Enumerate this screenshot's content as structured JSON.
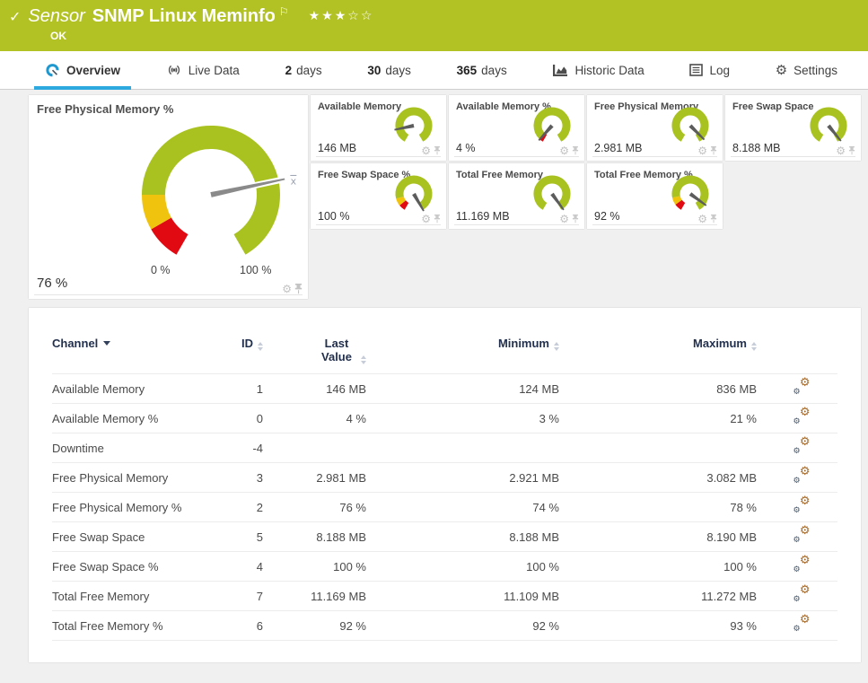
{
  "header": {
    "kind": "Sensor",
    "title": "SNMP Linux Meminfo",
    "status": "OK",
    "stars": "★★★☆☆",
    "stars_filled": 3,
    "stars_total": 5
  },
  "icons": {
    "check": "✓",
    "flag": "⚐",
    "gear": "⚙",
    "avg_marker": "x"
  },
  "colors": {
    "header_bg": "#b2c224",
    "green": "#a9c21f",
    "yellow": "#f0c30f",
    "red": "#e10a12",
    "accent_blue": "#2ea9e0",
    "needle_main": "#8a8a8a",
    "needle_small": "#5c5c5c"
  },
  "tabs": [
    {
      "icon": "gauge",
      "strong": "",
      "label": "Overview",
      "active": true
    },
    {
      "icon": "live",
      "strong": "",
      "label": "Live Data",
      "active": false
    },
    {
      "icon": "",
      "strong": "2",
      "label": "days",
      "active": false
    },
    {
      "icon": "",
      "strong": "30",
      "label": "days",
      "active": false
    },
    {
      "icon": "",
      "strong": "365",
      "label": "days",
      "active": false
    },
    {
      "icon": "historic",
      "strong": "",
      "label": "Historic Data",
      "active": false
    },
    {
      "icon": "log",
      "strong": "",
      "label": "Log",
      "active": false
    },
    {
      "icon": "settings",
      "strong": "",
      "label": "Settings",
      "active": false
    }
  ],
  "panels": {
    "main": {
      "title": "Free Physical Memory %",
      "value": "76 %",
      "min": "0 %",
      "max": "100 %",
      "needle_pct": 76,
      "avg_pct": 77,
      "segments": [
        [
          0,
          10,
          "red"
        ],
        [
          10,
          20,
          "yellow"
        ],
        [
          20,
          100,
          "green"
        ]
      ]
    },
    "small": [
      {
        "title": "Available Memory",
        "value": "146 MB",
        "needle_pct": 16,
        "segments": [
          [
            0,
            100,
            "green"
          ]
        ]
      },
      {
        "title": "Available Memory %",
        "value": "4 %",
        "needle_pct": 4,
        "segments": [
          [
            0,
            5,
            "red"
          ],
          [
            5,
            100,
            "green"
          ]
        ]
      },
      {
        "title": "Free Physical Memory",
        "value": "2.981 MB",
        "needle_pct": 95,
        "segments": [
          [
            0,
            100,
            "green"
          ]
        ]
      },
      {
        "title": "Free Swap Space",
        "value": "8.188 MB",
        "needle_pct": 97,
        "segments": [
          [
            0,
            100,
            "green"
          ]
        ]
      },
      {
        "title": "Free Swap Space %",
        "value": "100 %",
        "needle_pct": 100,
        "segments": [
          [
            0,
            7,
            "red"
          ],
          [
            7,
            15,
            "yellow"
          ],
          [
            15,
            100,
            "green"
          ]
        ]
      },
      {
        "title": "Total Free Memory",
        "value": "11.169 MB",
        "needle_pct": 98,
        "segments": [
          [
            0,
            100,
            "green"
          ]
        ]
      },
      {
        "title": "Total Free Memory %",
        "value": "92 %",
        "needle_pct": 92,
        "segments": [
          [
            0,
            8,
            "red"
          ],
          [
            8,
            16,
            "yellow"
          ],
          [
            16,
            100,
            "green"
          ]
        ]
      }
    ]
  },
  "table": {
    "columns": [
      {
        "label": "Channel",
        "sorted": true
      },
      {
        "label": "ID"
      },
      {
        "label": "Last Value"
      },
      {
        "label": "Minimum"
      },
      {
        "label": "Maximum"
      }
    ],
    "rows": [
      {
        "channel": "Available Memory",
        "id": "1",
        "last": "146 MB",
        "min": "124 MB",
        "max": "836 MB"
      },
      {
        "channel": "Available Memory %",
        "id": "0",
        "last": "4 %",
        "min": "3 %",
        "max": "21 %"
      },
      {
        "channel": "Downtime",
        "id": "-4",
        "last": "",
        "min": "",
        "max": ""
      },
      {
        "channel": "Free Physical Memory",
        "id": "3",
        "last": "2.981 MB",
        "min": "2.921 MB",
        "max": "3.082 MB"
      },
      {
        "channel": "Free Physical Memory %",
        "id": "2",
        "last": "76 %",
        "min": "74 %",
        "max": "78 %"
      },
      {
        "channel": "Free Swap Space",
        "id": "5",
        "last": "8.188 MB",
        "min": "8.188 MB",
        "max": "8.190 MB"
      },
      {
        "channel": "Free Swap Space %",
        "id": "4",
        "last": "100 %",
        "min": "100 %",
        "max": "100 %"
      },
      {
        "channel": "Total Free Memory",
        "id": "7",
        "last": "11.169 MB",
        "min": "11.109 MB",
        "max": "11.272 MB"
      },
      {
        "channel": "Total Free Memory %",
        "id": "6",
        "last": "92 %",
        "min": "92 %",
        "max": "93 %"
      }
    ]
  }
}
